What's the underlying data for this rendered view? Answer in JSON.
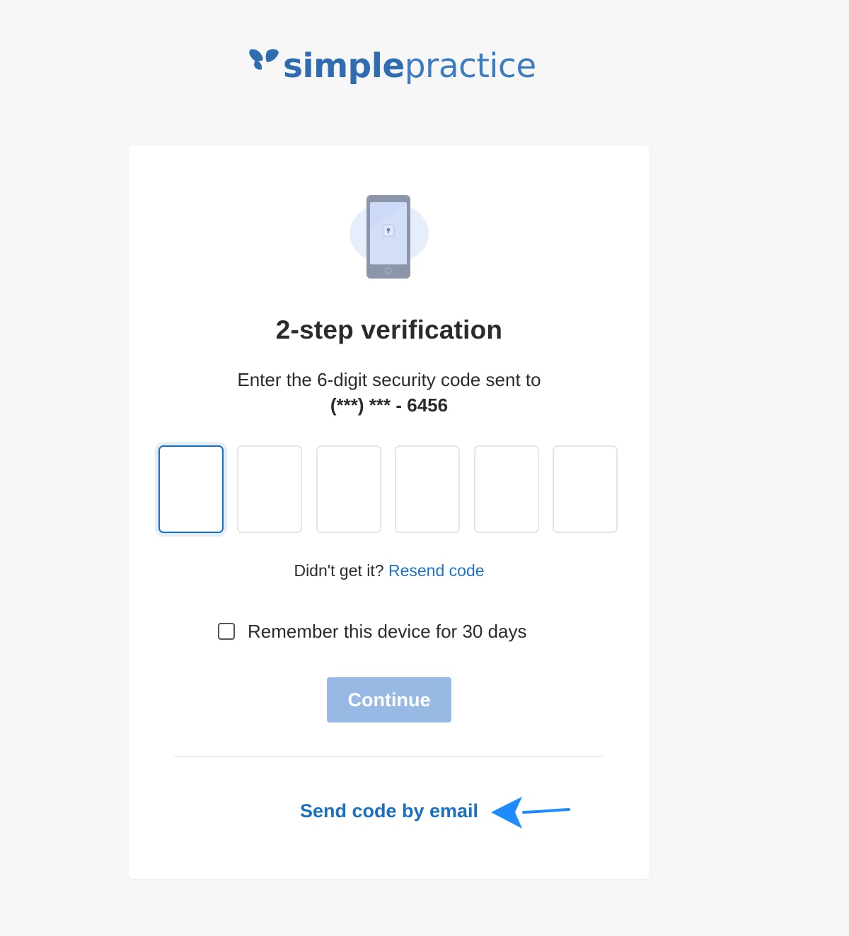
{
  "brand": {
    "logo_bold": "simple",
    "logo_light": "practice",
    "brand_color": "#2f6db0"
  },
  "card": {
    "illustration_icon": "phone-lock-icon",
    "title": "2-step verification",
    "subtitle": "Enter the 6-digit security code sent to",
    "phone_number": "(***) *** - 6456",
    "code_inputs": [
      "",
      "",
      "",
      "",
      "",
      ""
    ],
    "resend_prompt": "Didn't get it?",
    "resend_link": "Resend code",
    "remember_label": "Remember this device for 30 days",
    "remember_checked": false,
    "continue_label": "Continue",
    "continue_disabled": true,
    "email_link": "Send code by email"
  },
  "annotation": {
    "arrow_icon": "arrow-left-icon",
    "arrow_color": "#1e8cff"
  },
  "colors": {
    "link": "#1b75c9",
    "button_disabled": "#97b9e4",
    "focus_border": "#1a6fbf"
  }
}
